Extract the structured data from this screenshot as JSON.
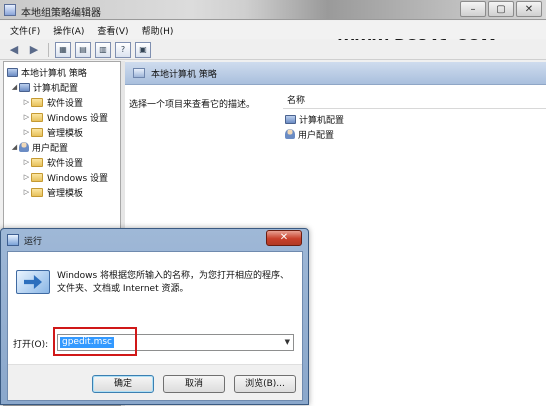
{
  "watermark": "WWW.PC841.COM",
  "gpedit": {
    "title": "本地组策略编辑器",
    "window_buttons": [
      "–",
      "▢",
      "✕"
    ],
    "menu": [
      "文件(F)",
      "操作(A)",
      "查看(V)",
      "帮助(H)"
    ],
    "tree": {
      "root": "本地计算机 策略",
      "computer_config": "计算机配置",
      "user_config": "用户配置",
      "computer_children": [
        "软件设置",
        "Windows 设置",
        "管理模板"
      ],
      "user_children": [
        "软件设置",
        "Windows 设置",
        "管理模板"
      ]
    },
    "right_header": "本地计算机 策略",
    "description": "选择一个项目来查看它的描述。",
    "column_name": "名称",
    "items": [
      "计算机配置",
      "用户配置"
    ]
  },
  "run_dialog": {
    "title": "运行",
    "close_glyph": "✕",
    "description": "Windows 将根据您所输入的名称，为您打开相应的程序、文件夹、文档或 Internet 资源。",
    "open_label": "打开(O):",
    "open_value": "gpedit.msc",
    "ok": "确定",
    "cancel": "取消",
    "browse": "浏览(B)..."
  }
}
